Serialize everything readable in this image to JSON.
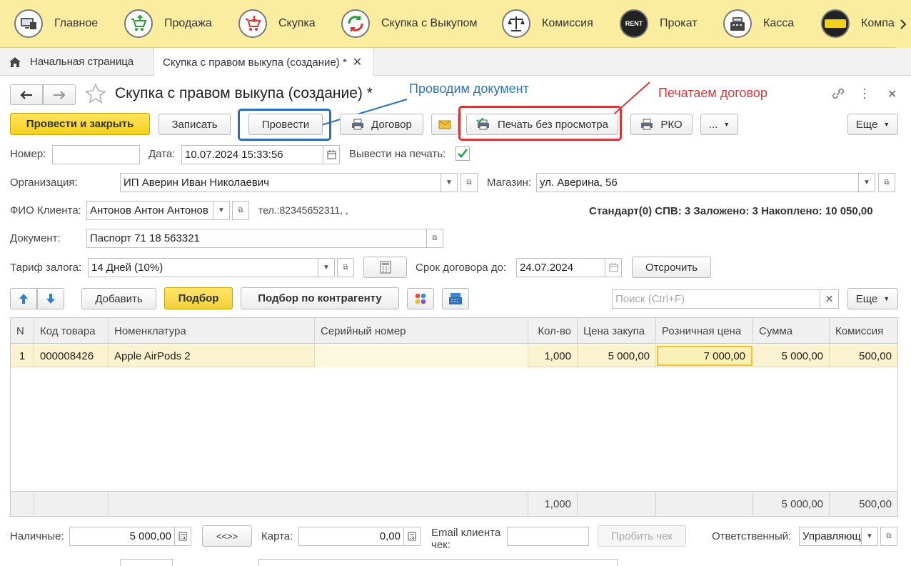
{
  "nav": {
    "items": [
      {
        "label": "Главное",
        "icon": "monitor-icon"
      },
      {
        "label": "Продажа",
        "icon": "cart-up-icon"
      },
      {
        "label": "Скупка",
        "icon": "cart-down-icon"
      },
      {
        "label": "Скупка с Выкупом",
        "icon": "cycle-icon"
      },
      {
        "label": "Комиссия",
        "icon": "scales-icon"
      },
      {
        "label": "Прокат",
        "icon": "rent-icon"
      },
      {
        "label": "Касса",
        "icon": "cash-register-icon"
      },
      {
        "label": "Компания",
        "icon": "company-logo-icon"
      }
    ],
    "rent_badge": "RENT"
  },
  "tabs": {
    "home": "Начальная страница",
    "active": "Скупка с правом выкупа (создание) *"
  },
  "doc": {
    "title": "Скупка с правом выкупа (создание) *"
  },
  "annotations": {
    "post": "Проводим документ",
    "print": "Печатаем договор"
  },
  "toolbar": {
    "post_close": "Провести и закрыть",
    "save": "Записать",
    "post": "Провести",
    "contract": "Договор",
    "print_no_preview": "Печать без просмотра",
    "rko": "РКО",
    "more_dots": "...",
    "more": "Еще"
  },
  "fields": {
    "number_label": "Номер:",
    "number_value": "",
    "date_label": "Дата:",
    "date_value": "10.07.2024 15:33:56",
    "print_label": "Вывести на печать:",
    "org_label": "Организация:",
    "org_value": "ИП Аверин Иван Николаевич",
    "shop_label": "Магазин:",
    "shop_value": "ул. Аверина, 56",
    "client_label": "ФИО Клиента:",
    "client_value": "Антонов Антон Антонов",
    "phone": "тел.:82345652311, ,",
    "client_stats": "Стандарт(0) СПВ: 3 Заложено: 3 Накоплено: 10 050,00",
    "document_label": "Документ:",
    "document_value": "Паспорт 71 18 563321",
    "tariff_label": "Тариф залога:",
    "tariff_value": "14 Дней (10%)",
    "term_label": "Срок договора до:",
    "term_value": "24.07.2024",
    "extend": "Отсрочить"
  },
  "table_toolbar": {
    "add": "Добавить",
    "selection": "Подбор",
    "selection_by_partner": "Подбор по контрагенту",
    "search_placeholder": "Поиск (Ctrl+F)",
    "more": "Еще"
  },
  "table": {
    "columns": [
      "N",
      "Код товара",
      "Номенклатура",
      "Серийный номер",
      "Кол-во",
      "Цена закупа",
      "Розничная цена",
      "Сумма",
      "Комиссия"
    ],
    "rows": [
      {
        "n": "1",
        "code": "000008426",
        "name": "Apple AirPods 2",
        "serial": "",
        "qty": "1,000",
        "buy_price": "5 000,00",
        "retail_price": "7 000,00",
        "sum": "5 000,00",
        "commission": "500,00"
      }
    ],
    "totals": {
      "qty": "1,000",
      "sum": "5 000,00",
      "commission": "500,00"
    }
  },
  "footer": {
    "cash_label": "Наличные:",
    "cash_value": "5 000,00",
    "swap": "<<>>",
    "card_label": "Карта:",
    "card_value": "0,00",
    "email_label": "Email клиента чек:",
    "email_value": "",
    "punch_receipt": "Пробить чек",
    "responsible_label": "Ответственный:",
    "responsible_value": "Управляющ"
  },
  "colors": {
    "nav_bg": "#fbeda0",
    "primary_button": "#f5cf1e",
    "selected_row": "#fbf3cf",
    "annotation_blue": "#2e74b5",
    "annotation_red": "#d03a3a"
  }
}
